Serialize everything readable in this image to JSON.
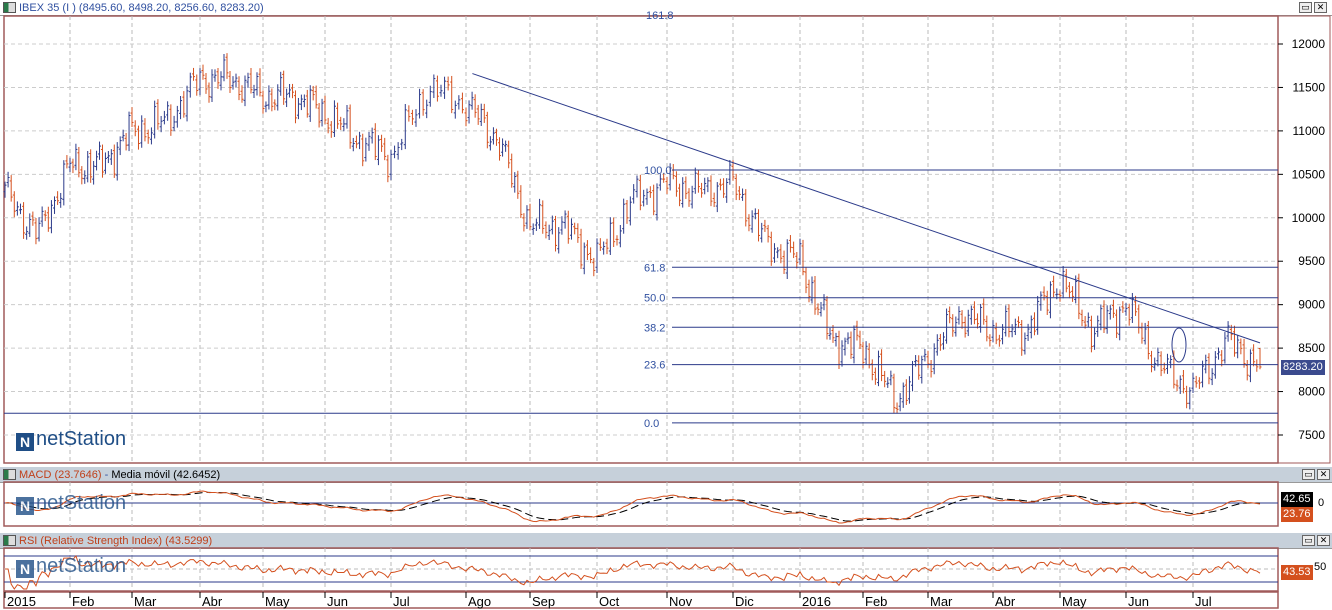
{
  "main": {
    "title": "IBEX 35 (I ) (8495.60, 8498.20, 8256.60, 8283.20)",
    "last_label": "8283.20",
    "watermark": "netStation"
  },
  "macd": {
    "title_a": "MACD (23.7646)",
    "sep": " - ",
    "title_b": "Media móvil (42.6452)",
    "label_signal": "42.65",
    "label_macd": "23.76",
    "zero_label": "0"
  },
  "rsi": {
    "title": "RSI (Relative Strength Index) (43.5299)",
    "value_label": "43.53",
    "mid_label": "50"
  },
  "colors": {
    "up": "#2b3a8a",
    "down": "#d4501e",
    "line": "#2b3a8a",
    "frame": "#a05a5a"
  },
  "chart_data": {
    "type": "bar",
    "title": "IBEX 35 (I )",
    "ohlc_last": {
      "open": 8495.6,
      "high": 8498.2,
      "low": 8256.6,
      "close": 8283.2
    },
    "ylim": [
      7200,
      12300
    ],
    "yticks": [
      12000,
      11500,
      11000,
      10500,
      10000,
      9500,
      9000,
      8500,
      8000,
      7500
    ],
    "x_ticks": [
      "2015",
      "Feb",
      "Mar",
      "Abr",
      "May",
      "Jun",
      "Jul",
      "Ago",
      "Sep",
      "Oct",
      "Nov",
      "Dic",
      "2016",
      "Feb",
      "Mar",
      "Abr",
      "May",
      "Jun",
      "Jul"
    ],
    "half_month_closes": [
      10300,
      9800,
      10600,
      10600,
      11000,
      11100,
      11600,
      11600,
      11400,
      11400,
      11200,
      10900,
      10700,
      11500,
      11300,
      10900,
      9900,
      9900,
      9500,
      10200,
      10400,
      10300,
      10400,
      9700,
      9500,
      8600,
      8500,
      7900,
      8400,
      8900,
      8700,
      8700,
      9300,
      8700,
      9000,
      8300,
      8000,
      8600,
      8283
    ],
    "fibonacci": [
      {
        "label": "161.8",
        "price": 12300
      },
      {
        "label": "100.0",
        "price": 10550
      },
      {
        "label": "61.8",
        "price": 9430
      },
      {
        "label": "50.0",
        "price": 9080
      },
      {
        "label": "38.2",
        "price": 8740
      },
      {
        "label": "23.6",
        "price": 8310
      },
      {
        "label": "0.0",
        "price": 7640
      }
    ],
    "support_line": 7750,
    "trendline": [
      {
        "x_half_month": 14.2,
        "price": 11660
      },
      {
        "x_half_month": 38.7,
        "price": 8560
      }
    ],
    "macd": {
      "macd": 23.7646,
      "signal": 42.6452
    },
    "rsi": {
      "value": 43.5299,
      "bands": [
        30,
        70
      ]
    }
  }
}
